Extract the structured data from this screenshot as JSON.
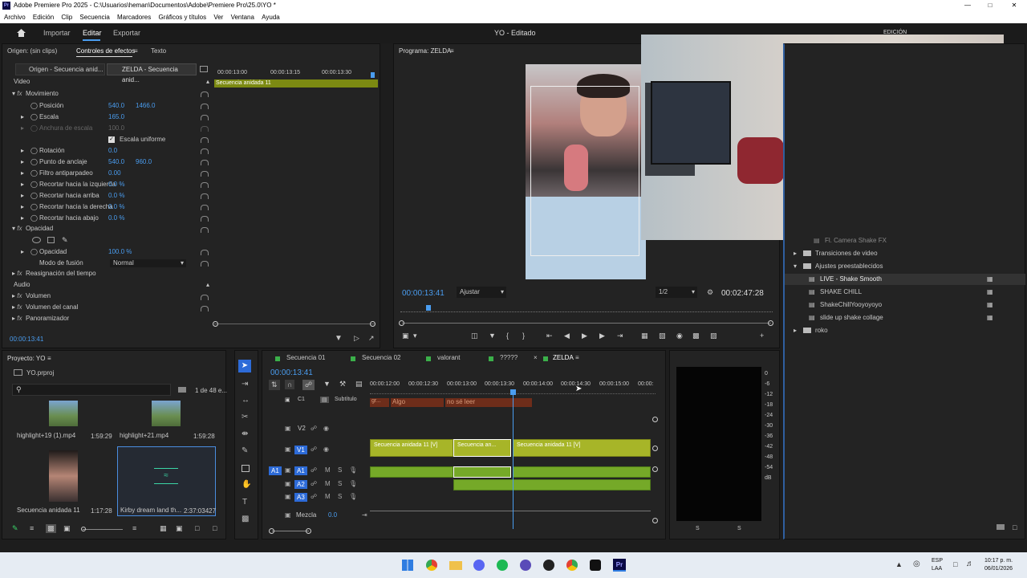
{
  "window": {
    "title": "Adobe Premiere Pro 2025 - C:\\Usuarios\\heman\\Documentos\\Adobe\\Premiere Pro\\25.0\\YO *",
    "menu": [
      "Archivo",
      "Edición",
      "Clip",
      "Secuencia",
      "Marcadores",
      "Gráficos y títulos",
      "Ver",
      "Ventana",
      "Ayuda"
    ]
  },
  "header": {
    "tabs": [
      "Importar",
      "Editar",
      "Exportar"
    ],
    "active_tab": "Editar",
    "project_title": "YO - Editado",
    "workspace_label": "EDICIÓN"
  },
  "source_panel": {
    "tabs": [
      "Origen: (sin clips)",
      "Controles de efectos",
      "Texto"
    ],
    "source_selector": "Origen - Secuencia anid...",
    "target_selector": "ZELDA - Secuencia anid...",
    "ruler_times": [
      "00:00:13:00",
      "00:00:13:15",
      "00:00:13:30"
    ],
    "nested_clip": "Secuencia anidada 11",
    "section_video": "Video",
    "section_audio": "Audio",
    "motion": "Movimiento",
    "rows": [
      {
        "name": "Posición",
        "v1": "540.0",
        "v2": "1466.0"
      },
      {
        "name": "Escala",
        "v1": "165.0",
        "v2": ""
      },
      {
        "name": "Anchura de escala",
        "v1": "100.0",
        "v2": ""
      },
      {
        "name": "Escala uniforme",
        "v1": "",
        "v2": ""
      },
      {
        "name": "Rotación",
        "v1": "0.0",
        "v2": ""
      },
      {
        "name": "Punto de anclaje",
        "v1": "540.0",
        "v2": "960.0"
      },
      {
        "name": "Filtro antiparpadeo",
        "v1": "0.00",
        "v2": ""
      },
      {
        "name": "Recortar hacia la izquierda",
        "v1": "0.0 %",
        "v2": ""
      },
      {
        "name": "Recortar hacia arriba",
        "v1": "0.0 %",
        "v2": ""
      },
      {
        "name": "Recortar hacia la derecha",
        "v1": "0.0 %",
        "v2": ""
      },
      {
        "name": "Recortar hacia abajo",
        "v1": "0.0 %",
        "v2": ""
      }
    ],
    "opacity": "Opacidad",
    "opacity_value": "100.0 %",
    "blend_mode_label": "Modo de fusión",
    "blend_mode": "Normal",
    "time_remap": "Reasignación del tiempo",
    "audio_rows": [
      "Volumen",
      "Volumen del canal",
      "Panoramizador"
    ],
    "timecode": "00:00:13:41"
  },
  "program": {
    "title": "Programa: ZELDA",
    "timecode": "00:00:13:41",
    "fit": "Ajustar",
    "resolution": "1/2",
    "duration": "00:02:47:28"
  },
  "effects_panel": {
    "items": [
      {
        "label": "Fl. Camera Shake FX",
        "level": 2
      },
      {
        "label": "Transiciones de video",
        "level": 1
      },
      {
        "label": "Ajustes preestablecidos",
        "level": 1
      },
      {
        "label": "LIVE - Shake Smooth",
        "level": 2
      },
      {
        "label": "SHAKE CHILL",
        "level": 2
      },
      {
        "label": "ShakeChillYooyoyoyo",
        "level": 2
      },
      {
        "label": "slide up shake collage",
        "level": 2
      },
      {
        "label": "roko",
        "level": 1
      }
    ]
  },
  "project_panel": {
    "title": "Proyecto: YO",
    "file": "YO.prproj",
    "count": "1 de 48 e...",
    "items": [
      {
        "name": "highlight+19 (1).mp4",
        "duration": "1:59:29"
      },
      {
        "name": "highlight+21.mp4",
        "duration": "1:59:28"
      },
      {
        "name": "Secuencia anidada 11",
        "duration": "1:17:28"
      },
      {
        "name": "Kirby dream land th...",
        "duration": "2:37:03427"
      }
    ]
  },
  "timeline": {
    "tabs": [
      "Secuencia 01",
      "Secuencia 02",
      "valorant",
      "?????",
      "ZELDA"
    ],
    "active_tab": "ZELDA",
    "timecode": "00:00:13:41",
    "ruler": [
      "00:00:12:00",
      "00:00:12:30",
      "00:00:13:00",
      "00:00:13:30",
      "00:00:14:00",
      "00:00:14:30",
      "00:00:15:00",
      "00:00:"
    ],
    "subtitle_track": "Subtítulo",
    "subtitles": [
      "gr...",
      "Algo",
      "no sé leer"
    ],
    "video_tracks": [
      "V2",
      "V1"
    ],
    "audio_tracks": [
      "A1",
      "A2",
      "A3"
    ],
    "clips": [
      "Secuencia anidada 11 [V]",
      "Secuencia an...",
      "Secuencia anidada 11 [V]"
    ],
    "mix_label": "Mezcla",
    "mix_value": "0.0"
  },
  "meter": {
    "scale": [
      "0",
      "-6",
      "-12",
      "-18",
      "-24",
      "-30",
      "-36",
      "-42",
      "-48",
      "-54",
      "dB"
    ],
    "channels": [
      "S",
      "S"
    ]
  },
  "taskbar": {
    "lang": "ESP",
    "region": "LAA",
    "time": "10:17 p. m.",
    "date": "06/01/2026"
  }
}
